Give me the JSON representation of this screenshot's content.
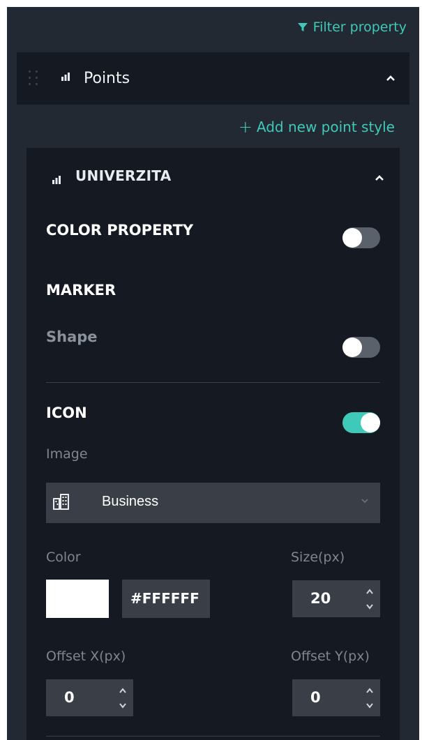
{
  "filter": {
    "label": "Filter property",
    "icon": "filter-icon"
  },
  "section": {
    "title": "Points",
    "icon": "bar-chart-icon",
    "expanded": true
  },
  "add_style": {
    "label": "Add new point style",
    "icon": "plus-icon"
  },
  "style_card": {
    "title": "UNIVERZITA",
    "icon": "bar-chart-icon",
    "color_property": {
      "label": "COLOR PROPERTY",
      "enabled": false
    },
    "marker": {
      "label": "MARKER",
      "shape": {
        "label": "Shape",
        "enabled": false
      }
    },
    "icon_section": {
      "label": "ICON",
      "enabled": true,
      "image": {
        "label": "Image",
        "selected": "Business",
        "icon": "building-icon"
      },
      "color": {
        "label": "Color",
        "value": "#FFFFFF"
      },
      "size": {
        "label": "Size(px)",
        "value": "20"
      },
      "offset_x": {
        "label": "Offset X(px)",
        "value": "0"
      },
      "offset_y": {
        "label": "Offset Y(px)",
        "value": "0"
      }
    }
  },
  "colors": {
    "accent": "#3fc9b8",
    "panel": "#232933",
    "card": "#141922",
    "input": "#3a3f47"
  }
}
